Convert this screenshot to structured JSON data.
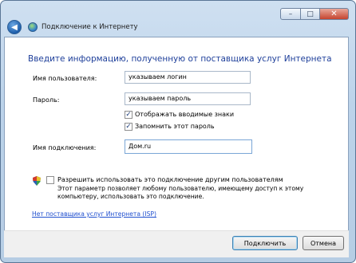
{
  "window": {
    "title": "Подключение к Интернету",
    "controls": {
      "minimize": "–",
      "maximize": "□",
      "close": "✕"
    }
  },
  "main": {
    "heading": "Введите информацию, полученную от поставщика услуг Интернета",
    "username": {
      "label": "Имя пользователя:",
      "value": "указываем логин"
    },
    "password": {
      "label": "Пароль:",
      "value": "указываем пароль"
    },
    "show_chars": {
      "label": "Отображать вводимые знаки",
      "checked": true,
      "mark": "✓"
    },
    "remember_password": {
      "label": "Запомнить этот пароль",
      "checked": true,
      "mark": "✓"
    },
    "connection_name": {
      "label": "Имя подключения:",
      "value": "Дом.ru"
    },
    "allow_others": {
      "label": "Разрешить использовать это подключение другим пользователям",
      "description": "Этот параметр позволяет любому пользователю, имеющему доступ к этому компьютеру, использовать это подключение.",
      "checked": false
    },
    "no_isp_link": "Нет поставщика услуг Интернета (ISP)"
  },
  "footer": {
    "connect": "Подключить",
    "cancel": "Отмена"
  },
  "colors": {
    "heading": "#1e3f9a",
    "link": "#1f4fcf",
    "title_bar": "#bcd3ea"
  }
}
